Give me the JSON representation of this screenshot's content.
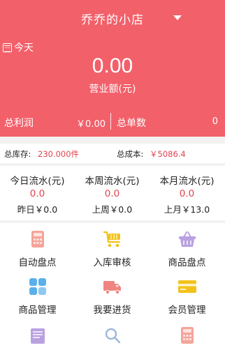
{
  "header": {
    "store_name": "乔乔的小店",
    "today_label": "今天",
    "sales_value": "0.00",
    "sales_label": "营业额(元)",
    "profit_label": "总利润",
    "profit_value": "￥0.00",
    "orders_label": "总单数",
    "orders_value": "0"
  },
  "stats": {
    "stock_label": "总库存:",
    "stock_value": "230.000件",
    "cost_label": "总成本:",
    "cost_value": "￥5086.4"
  },
  "flows": [
    {
      "title": "今日流水(元)",
      "value": "0.0",
      "prev": "昨日￥0.0"
    },
    {
      "title": "本周流水(元)",
      "value": "0.0",
      "prev": "上周￥0.0"
    },
    {
      "title": "本月流水(元)",
      "value": "0.0",
      "prev": "上月￥13.0"
    }
  ],
  "menu": [
    {
      "label": "自动盘点",
      "icon": "calculator-icon",
      "color": "#f4a49a"
    },
    {
      "label": "入库审核",
      "icon": "cart-icon",
      "color": "#f2c21a"
    },
    {
      "label": "商品盘点",
      "icon": "basket-icon",
      "color": "#b9a1e0"
    },
    {
      "label": "商品管理",
      "icon": "grid-icon",
      "color": "#5ab0ea"
    },
    {
      "label": "我要进货",
      "icon": "truck-icon",
      "color": "#f0857f"
    },
    {
      "label": "会员管理",
      "icon": "card-icon",
      "color": "#f2c21a"
    }
  ],
  "colors": {
    "header_bg": "#f2606a",
    "accent_red": "#e2434f",
    "page_bg": "#f2f2f2"
  }
}
